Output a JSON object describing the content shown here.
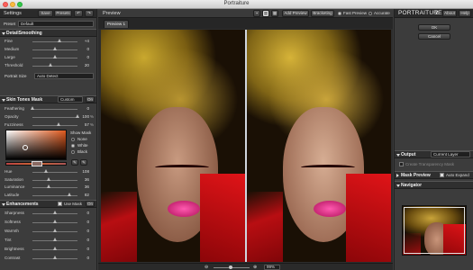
{
  "window": {
    "title": "Portraiture"
  },
  "left": {
    "header": {
      "title": "Settings",
      "save": "Save",
      "presets": "Presets"
    },
    "preset": {
      "label": "Preset",
      "value": "Default"
    },
    "detail": {
      "title": "DetailSmoothing",
      "sliders": [
        {
          "label": "Fine",
          "value": "+4",
          "pos": 0.6
        },
        {
          "label": "Medium",
          "value": "0",
          "pos": 0.5
        },
        {
          "label": "Large",
          "value": "0",
          "pos": 0.5
        },
        {
          "label": "Threshold",
          "value": "20",
          "pos": 0.4
        }
      ],
      "portrait_size": {
        "label": "Portrait Size",
        "value": "Auto Detect"
      }
    },
    "mask": {
      "title": "Skin Tones Mask",
      "mode": "Custom",
      "toggle": "On",
      "sliders": [
        {
          "label": "Feathering",
          "value": "0",
          "pct": "",
          "pos": 0.0
        },
        {
          "label": "Opacity",
          "value": "100",
          "pct": "%",
          "pos": 1.0
        },
        {
          "label": "Fuzziness",
          "value": "57",
          "pct": "%",
          "pos": 0.57
        }
      ],
      "show_mask": {
        "label": "Show Mask",
        "options": [
          "None",
          "White",
          "Black"
        ]
      },
      "hsl": [
        {
          "label": "Hue",
          "value": "108",
          "pos": 0.3
        },
        {
          "label": "Saturation",
          "value": "36",
          "pos": 0.36
        },
        {
          "label": "Luminance",
          "value": "36",
          "pos": 0.36
        },
        {
          "label": "Latitude",
          "value": "82",
          "pos": 0.82
        }
      ]
    },
    "enh": {
      "title": "Enhancements",
      "use_mask": "Use Mask",
      "toggle": "On",
      "sliders": [
        {
          "label": "Sharpness",
          "value": "0",
          "pos": 0.5
        },
        {
          "label": "Softness",
          "value": "0",
          "pos": 0.5
        },
        {
          "label": "Warmth",
          "value": "0",
          "pos": 0.5
        },
        {
          "label": "Tint",
          "value": "0",
          "pos": 0.5
        },
        {
          "label": "Brightness",
          "value": "0",
          "pos": 0.5
        },
        {
          "label": "Contrast",
          "value": "0",
          "pos": 0.5
        }
      ]
    }
  },
  "center": {
    "title": "Preview",
    "tab": "Preview 1",
    "add_preview": "Add Preview",
    "bracketing": "Bracketing",
    "fast_preview": "Fast Preview",
    "accurate": "Accurate",
    "zoom": "99%"
  },
  "right": {
    "brand_main": "PORTRAITURE",
    "brand_ver": "2",
    "about": "About",
    "help": "Help",
    "ok": "OK",
    "cancel": "Cancel",
    "output": {
      "title": "Output",
      "value": "Current Layer"
    },
    "transparency": "Create Transparency Mask",
    "mask_preview": {
      "title": "Mask Preview",
      "auto": "Auto Expand"
    },
    "navigator": "Navigator"
  },
  "colors": {
    "accent": "#d4b03c",
    "red": "#d01018",
    "panel": "#3c3c3c"
  }
}
